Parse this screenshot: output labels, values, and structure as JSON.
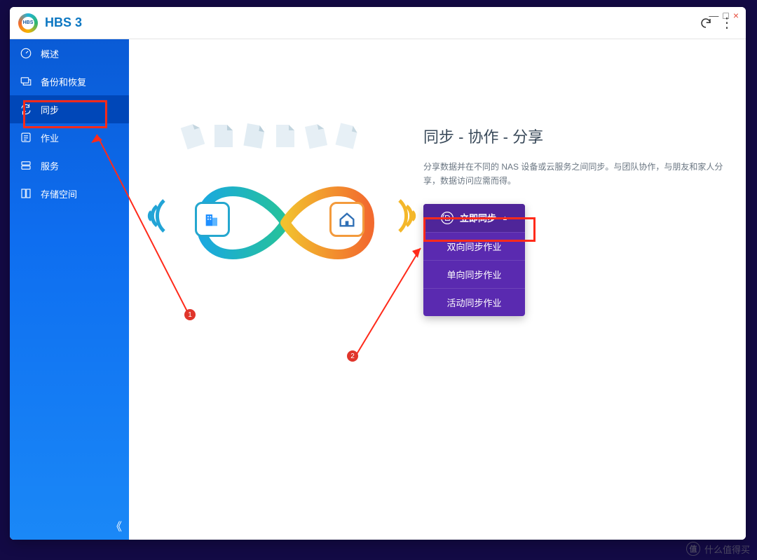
{
  "titlebar": {
    "app_name": "HBS 3",
    "minimize": "—",
    "maximize": "□",
    "close": "×"
  },
  "sidebar": {
    "items": [
      {
        "label": "概述"
      },
      {
        "label": "备份和恢复"
      },
      {
        "label": "同步"
      },
      {
        "label": "作业"
      },
      {
        "label": "服务"
      },
      {
        "label": "存储空间"
      }
    ],
    "collapse": "《"
  },
  "main": {
    "heading": "同步 - 协作 - 分享",
    "description": "分享数据并在不同的 NAS 设备或云服务之间同步。与团队协作，与朋友和家人分享，数据访问应需而得。"
  },
  "sync_menu": {
    "header": "立即同步",
    "items": [
      "双向同步作业",
      "单向同步作业",
      "活动同步作业"
    ]
  },
  "annotations": {
    "badge1": "1",
    "badge2": "2"
  },
  "watermark": {
    "logo_text": "值",
    "text": "什么值得买"
  }
}
